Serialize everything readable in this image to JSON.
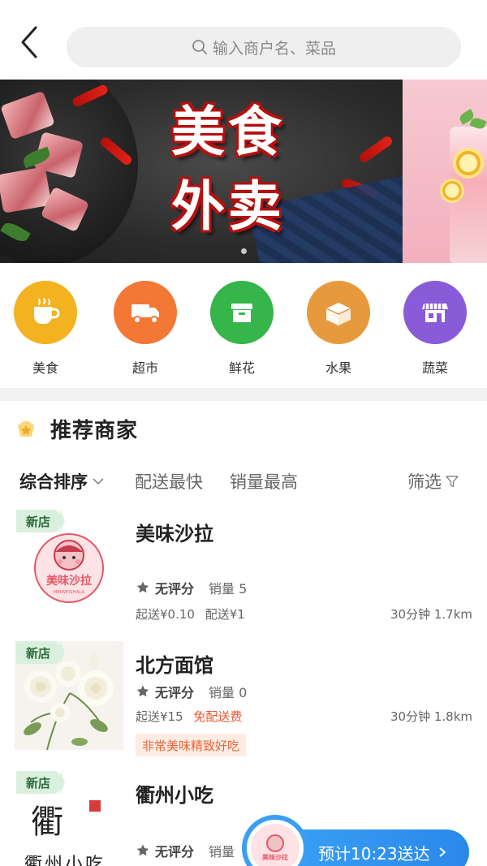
{
  "header": {
    "search_placeholder": "输入商户名、菜品"
  },
  "banner": {
    "title_line1": "美食",
    "title_line2": "外卖"
  },
  "categories": [
    {
      "label": "美食",
      "icon": "coffee-cup-icon",
      "color": "#f3b21f"
    },
    {
      "label": "超市",
      "icon": "truck-icon",
      "color": "#f37735"
    },
    {
      "label": "鲜花",
      "icon": "box-icon",
      "color": "#35b54a"
    },
    {
      "label": "水果",
      "icon": "open-box-icon",
      "color": "#e79a3d"
    },
    {
      "label": "蔬菜",
      "icon": "store-icon",
      "color": "#8a5bd8"
    }
  ],
  "section": {
    "title": "推荐商家"
  },
  "sortbar": {
    "comprehensive": "综合排序",
    "fastest": "配送最快",
    "top_sales": "销量最高",
    "filter": "筛选"
  },
  "shops": [
    {
      "tag": "新店",
      "name": "美味沙拉",
      "logo_text": "美味沙拉",
      "logo_subtext": "MEIWEISHALA",
      "rating": "无评分",
      "sales": "销量 5",
      "min_order": "起送¥0.10",
      "delivery_fee": "配送¥1",
      "eta_distance": "30分钟 1.7km"
    },
    {
      "tag": "新店",
      "name": "北方面馆",
      "rating": "无评分",
      "sales": "销量 0",
      "min_order": "起送¥15",
      "delivery_fee": "免配送费",
      "eta_distance": "30分钟 1.8km",
      "promo": "非常美味精致好吃"
    },
    {
      "tag": "新店",
      "name": "衢州小吃",
      "logo_text": "衢州小吃",
      "rating": "无评分",
      "sales": "销量"
    }
  ],
  "cart": {
    "label": "预计10:23送达",
    "logo_text": "美味沙拉"
  },
  "colors": {
    "accent_blue": "#2a88ea",
    "promo_orange": "#e5673a",
    "new_tag_green": "#daf0de"
  }
}
